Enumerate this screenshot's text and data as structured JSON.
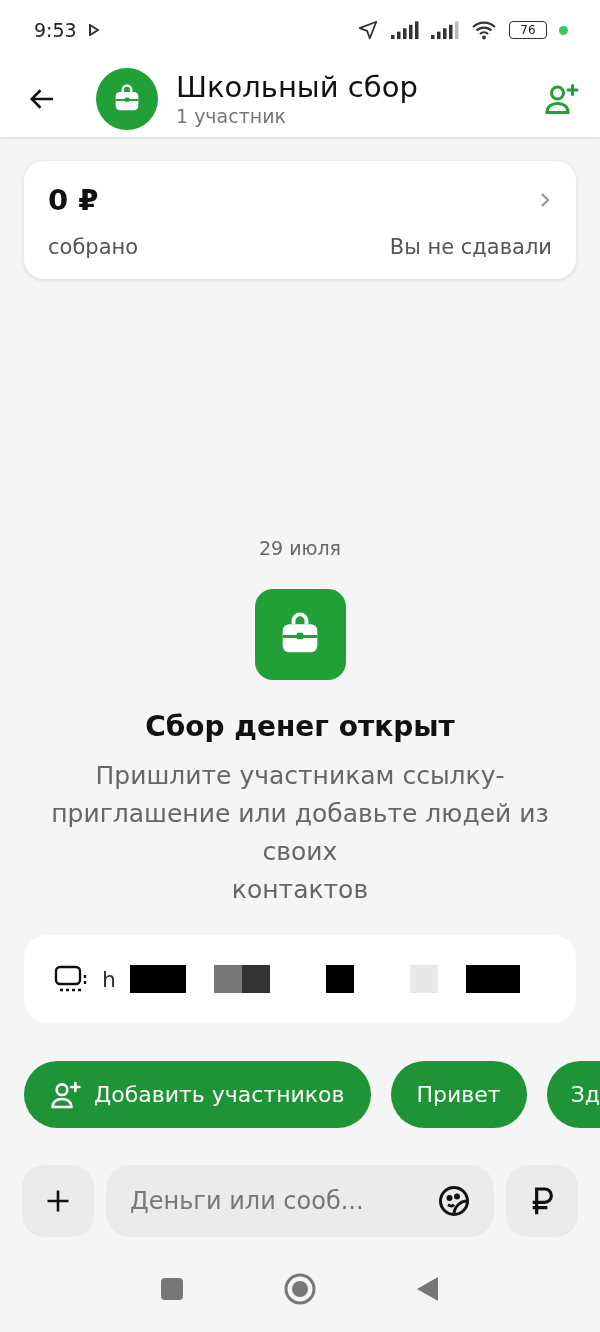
{
  "status_bar": {
    "time": "9:53",
    "battery": "76"
  },
  "header": {
    "title": "Школьный сбор",
    "subtitle": "1 участник"
  },
  "summary": {
    "amount": "0 ₽",
    "label": "собрано",
    "status": "Вы не сдавали"
  },
  "event": {
    "date": "29 июля",
    "title": "Сбор денег открыт",
    "text": "Пришлите участникам ссылку-\nприглашение или добавьте людей из\nсвоих\nконтактов"
  },
  "link": {
    "text": "h"
  },
  "chips": [
    {
      "kind": "add",
      "label": "Добавить участников"
    },
    {
      "kind": "text",
      "label": "Привет"
    },
    {
      "kind": "text",
      "label": "Зд"
    }
  ],
  "composer": {
    "placeholder": "Деньги или сооб..."
  }
}
